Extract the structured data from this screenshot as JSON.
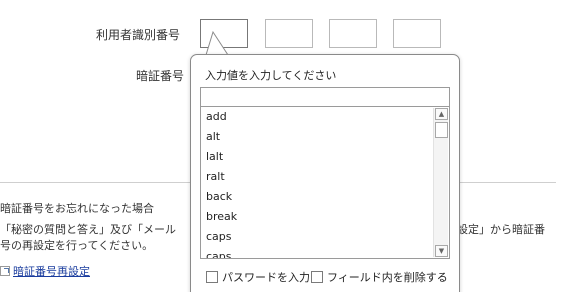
{
  "form": {
    "user_id_label": "利用者識別番号",
    "pin_label": "暗証番号",
    "id_boxes": [
      "",
      "",
      "",
      ""
    ]
  },
  "forgot": {
    "title": "暗証番号をお忘れになった場合",
    "body_line1_left": "「秘密の質問と答え」及び「メール",
    "body_line1_right": "設定」から暗証番",
    "body_line2": "号の再設定を行ってください。",
    "reset_link": "暗証番号再設定"
  },
  "popover": {
    "title": "入力値を入力してください",
    "input_value": "",
    "keys": [
      "add",
      "alt",
      "lalt",
      "ralt",
      "back",
      "break",
      "caps",
      "caps"
    ],
    "scroll_up_icon": "▲",
    "scroll_down_icon": "▼",
    "option_password": "パスワードを入力",
    "option_clear_field": "フィールド内を削除する"
  }
}
